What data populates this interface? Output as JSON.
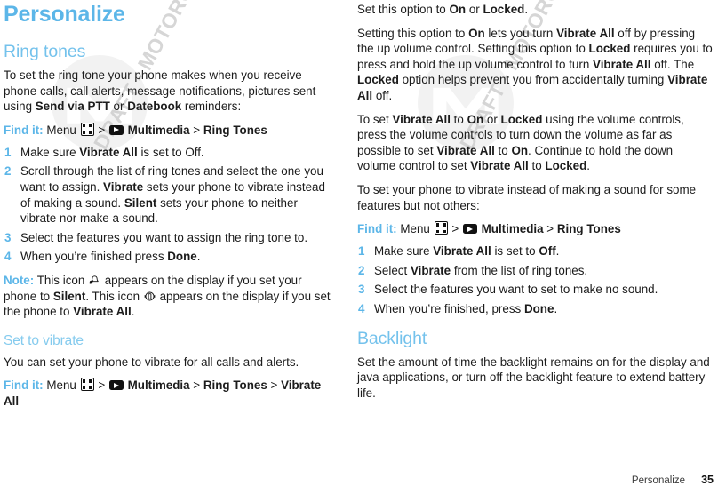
{
  "document": {
    "title": "Personalize",
    "colors": {
      "heading_blue": "#5cb6e8",
      "subheading_blue": "#74c2ec",
      "body_text": "#1c1c1c",
      "watermark_gray": "#c9c9c9"
    }
  },
  "watermark": {
    "text": "DRAFT - MOTOROLA CONFIDENTIAL & PROPRIETARY INFORMATION",
    "logo": "motorola-m-logo"
  },
  "icons": {
    "menu": "menu-key-icon",
    "multimedia": "multimedia-play-icon",
    "silent": "silent-bell-icon",
    "vibrate": "vibrate-icon"
  },
  "left_column": {
    "page_title": "Personalize",
    "section_heading": "Ring tones",
    "intro": {
      "part1": "To set the ring tone your phone makes when you receive phone calls, call alerts, message notifications, pictures sent using ",
      "bold1": "Send via PTT",
      "part2": " or ",
      "bold2": "Datebook",
      "part3": " reminders:"
    },
    "find_it": {
      "label": "Find it:",
      "menu": "Menu",
      "sep1": ">",
      "multimedia": "Multimedia",
      "sep2": ">",
      "target": "Ring Tones"
    },
    "steps": [
      {
        "num": "1",
        "p1": "Make sure ",
        "b1": "Vibrate All",
        "p2": " is set to Off.",
        "b2": "",
        "p3": ""
      },
      {
        "num": "2",
        "p1": "Scroll through the list of ring tones and select the one you want to assign. ",
        "b1": "Vibrate",
        "p2": " sets your phone to vibrate instead of making a sound. ",
        "b2": "Silent",
        "p3": " sets your phone to neither vibrate nor make a sound."
      },
      {
        "num": "3",
        "p1": "Select the features you want to assign the ring tone to.",
        "b1": "",
        "p2": "",
        "b2": "",
        "p3": ""
      },
      {
        "num": "4",
        "p1": "When you’re finished press ",
        "b1": "Done",
        "p2": ".",
        "b2": "",
        "p3": ""
      }
    ],
    "note": {
      "label": "Note:",
      "t1": " This icon ",
      "t2": " appears on the display if you set your phone to ",
      "b1": "Silent",
      "t3": ". This icon ",
      "t4": " appears on the display if you set the phone to ",
      "b2": "Vibrate All",
      "t5": "."
    },
    "subsection_heading": "Set to vibrate",
    "vibrate_intro": "You can set your phone to vibrate for all calls and alerts.",
    "find_it_2": {
      "label": "Find it:",
      "menu": "Menu",
      "sep1": ">",
      "multimedia": "Multimedia",
      "sep2": ">",
      "target": "Ring Tones",
      "sep3": ">",
      "target2": "Vibrate All"
    }
  },
  "right_column": {
    "para1": {
      "t1": "Set this option to ",
      "b1": "On",
      "t2": " or ",
      "b2": "Locked",
      "t3": "."
    },
    "para2": {
      "t1": "Setting this option to ",
      "b1": "On",
      "t2": " lets you turn ",
      "b2": "Vibrate All",
      "t3": " off by pressing the up volume control. Setting this option to ",
      "b3": "Locked",
      "t4": " requires you to press and hold the up volume control to turn ",
      "b4": "Vibrate All",
      "t5": " off. The ",
      "b5": "Locked",
      "t6": " option helps prevent you from accidentally turning ",
      "b6": "Vibrate All",
      "t7": " off."
    },
    "para3": {
      "t1": "To set ",
      "b1": "Vibrate All",
      "t2": " to ",
      "b2": "On",
      "t3": " or ",
      "b3": "Locked",
      "t4": " using the volume controls, press the volume controls to turn down the volume as far as possible to set ",
      "b4": "Vibrate All",
      "t5": " to ",
      "b5": "On",
      "t6": ". Continue to hold the down volume control to set ",
      "b6": "Vibrate All",
      "t7": " to ",
      "b7": "Locked",
      "t8": "."
    },
    "para4": "To set your phone to vibrate instead of making a sound for some features but not others:",
    "find_it": {
      "label": "Find it:",
      "menu": "Menu",
      "sep1": ">",
      "multimedia": "Multimedia",
      "sep2": ">",
      "target": "Ring Tones"
    },
    "steps": [
      {
        "num": "1",
        "p1": "Make sure ",
        "b1": "Vibrate All",
        "p2": " is set to ",
        "b2": "Off",
        "p3": "."
      },
      {
        "num": "2",
        "p1": "Select ",
        "b1": "Vibrate",
        "p2": " from the list of ring tones.",
        "b2": "",
        "p3": ""
      },
      {
        "num": "3",
        "p1": "Select the features you want to set to make no sound.",
        "b1": "",
        "p2": "",
        "b2": "",
        "p3": ""
      },
      {
        "num": "4",
        "p1": "When you’re finished, press ",
        "b1": "Done",
        "p2": ".",
        "b2": "",
        "p3": ""
      }
    ],
    "section_heading": "Backlight",
    "backlight_body": "Set the amount of time the backlight remains on for the display and java applications, or turn off the backlight feature to extend battery life."
  },
  "footer": {
    "chapter": "Personalize",
    "page_number": "35"
  }
}
